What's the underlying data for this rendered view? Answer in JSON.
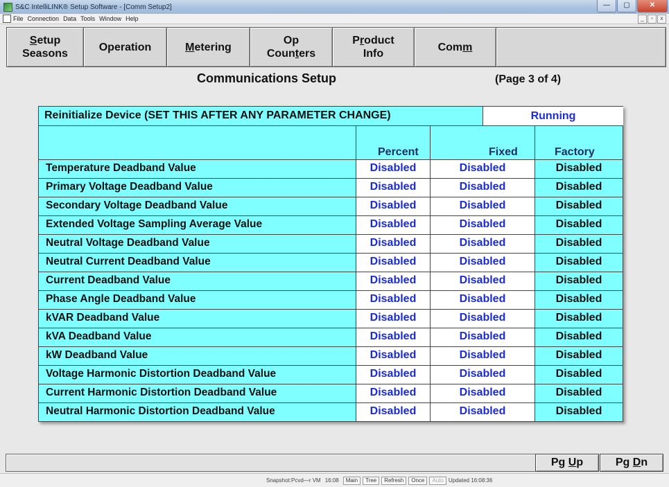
{
  "window": {
    "title": "S&C IntelliLINK® Setup Software - [Comm Setup2]",
    "buttons": {
      "minimize": "—",
      "restore": "▢",
      "close": "✕"
    }
  },
  "menubar": {
    "items": [
      "File",
      "Connection",
      "Data",
      "Tools",
      "Window",
      "Help"
    ],
    "mdi_buttons": [
      "_",
      "▫",
      "x"
    ]
  },
  "tabs": [
    {
      "line1_prefix": "",
      "line1_ul": "S",
      "line1_rest": "etup",
      "line2": "Seasons"
    },
    {
      "line1_prefix": "",
      "line1_ul": "",
      "line1_rest": "Operation",
      "line2": ""
    },
    {
      "line1_prefix": "",
      "line1_ul": "M",
      "line1_rest": "etering",
      "line2": ""
    },
    {
      "line1_prefix": "",
      "line1_ul": "",
      "line1_rest": "Op",
      "line2_prefix": "Coun",
      "line2_ul": "t",
      "line2_rest": "ers"
    },
    {
      "line1_prefix": "P",
      "line1_ul": "r",
      "line1_rest": "oduct",
      "line2": "Info"
    },
    {
      "line1_prefix": "Com",
      "line1_ul": "m",
      "line1_rest": "",
      "line2": ""
    },
    {
      "line1_prefix": "",
      "line1_ul": "",
      "line1_rest": "",
      "line2": ""
    }
  ],
  "heading": {
    "title": "Communications Setup",
    "page": "(Page 3 of 4)"
  },
  "reinitialize": {
    "label": "Reinitialize Device (SET THIS AFTER ANY PARAMETER CHANGE)",
    "status": "Running"
  },
  "table": {
    "columns": [
      "Percent",
      "Fixed",
      "Factory"
    ],
    "rows": [
      {
        "label": "Temperature Deadband Value",
        "percent": "Disabled",
        "fixed": "Disabled",
        "factory": "Disabled"
      },
      {
        "label": "Primary Voltage Deadband Value",
        "percent": "Disabled",
        "fixed": "Disabled",
        "factory": "Disabled"
      },
      {
        "label": "Secondary Voltage Deadband Value",
        "percent": "Disabled",
        "fixed": "Disabled",
        "factory": "Disabled"
      },
      {
        "label": "Extended Voltage Sampling Average Value",
        "percent": "Disabled",
        "fixed": "Disabled",
        "factory": "Disabled"
      },
      {
        "label": "Neutral Voltage Deadband Value",
        "percent": "Disabled",
        "fixed": "Disabled",
        "factory": "Disabled"
      },
      {
        "label": "Neutral Current Deadband Value",
        "percent": "Disabled",
        "fixed": "Disabled",
        "factory": "Disabled"
      },
      {
        "label": "Current Deadband Value",
        "percent": "Disabled",
        "fixed": "Disabled",
        "factory": "Disabled"
      },
      {
        "label": "Phase Angle Deadband Value",
        "percent": "Disabled",
        "fixed": "Disabled",
        "factory": "Disabled"
      },
      {
        "label": "kVAR Deadband Value",
        "percent": "Disabled",
        "fixed": "Disabled",
        "factory": "Disabled"
      },
      {
        "label": "kVA Deadband Value",
        "percent": "Disabled",
        "fixed": "Disabled",
        "factory": "Disabled"
      },
      {
        "label": "kW Deadband Value",
        "percent": "Disabled",
        "fixed": "Disabled",
        "factory": "Disabled"
      },
      {
        "label": "Voltage Harmonic Distortion Deadband Value",
        "percent": "Disabled",
        "fixed": "Disabled",
        "factory": "Disabled"
      },
      {
        "label": "Current Harmonic Distortion Deadband Value",
        "percent": "Disabled",
        "fixed": "Disabled",
        "factory": "Disabled"
      },
      {
        "label": "Neutral Harmonic Distortion Deadband Value",
        "percent": "Disabled",
        "fixed": "Disabled",
        "factory": "Disabled"
      }
    ]
  },
  "paging": {
    "up_prefix": "Pg ",
    "up_ul": "U",
    "up_rest": "p",
    "dn_prefix": "Pg ",
    "dn_ul": "D",
    "dn_rest": "n"
  },
  "bottom_strip": {
    "snapshot": "Snapshot:Pcvd—r VM",
    "time": "16:08",
    "buttons": [
      "Main",
      "Tree",
      "Refresh",
      "Once",
      "Auto"
    ],
    "updated": "Updated 16:08:36"
  },
  "colors": {
    "grid_background": "#7fffff",
    "value_blue": "#1a2bd8",
    "factory_text": "#111111"
  }
}
